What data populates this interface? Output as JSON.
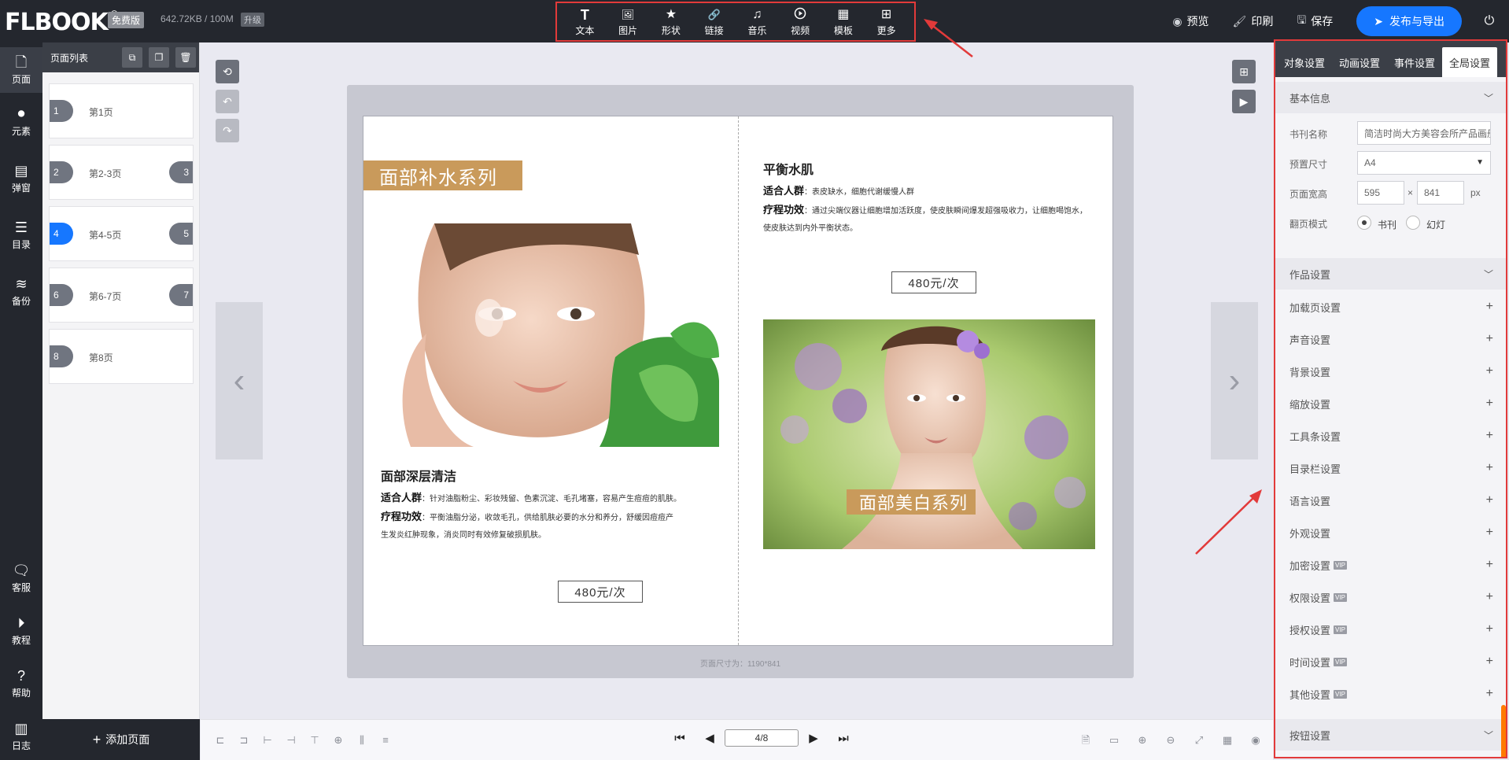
{
  "app": {
    "logo": "FLBOOK",
    "logo_mark": "®",
    "plan_badge": "免费版",
    "quota": "642.72KB / 100M",
    "upgrade": "升级"
  },
  "toolbar": [
    {
      "label": "文本",
      "icon": "T"
    },
    {
      "label": "图片",
      "icon": "🖼"
    },
    {
      "label": "形状",
      "icon": "★"
    },
    {
      "label": "链接",
      "icon": "🔗"
    },
    {
      "label": "音乐",
      "icon": "♫"
    },
    {
      "label": "视频",
      "icon": "▶"
    },
    {
      "label": "模板",
      "icon": "▦"
    },
    {
      "label": "更多",
      "icon": "⊞"
    }
  ],
  "top_actions": {
    "preview": "预览",
    "print": "印刷",
    "save": "保存",
    "publish": "发布与导出"
  },
  "leftnav": [
    {
      "label": "页面"
    },
    {
      "label": "元素"
    },
    {
      "label": "弹窗"
    },
    {
      "label": "目录"
    },
    {
      "label": "备份"
    },
    {
      "label": "客服"
    },
    {
      "label": "教程"
    },
    {
      "label": "帮助"
    },
    {
      "label": "日志"
    }
  ],
  "pagelist": {
    "title": "页面列表",
    "add_page": "添加页面",
    "pages": [
      {
        "num": "1",
        "name": "第1页",
        "right": ""
      },
      {
        "num": "2",
        "name": "第2-3页",
        "right": "3"
      },
      {
        "num": "4",
        "name": "第4-5页",
        "right": "5"
      },
      {
        "num": "6",
        "name": "第6-7页",
        "right": "7"
      },
      {
        "num": "8",
        "name": "第8页",
        "right": ""
      }
    ]
  },
  "book": {
    "left": {
      "banner": "面部补水系列",
      "title": "面部深层清洁",
      "audience_label": "适合人群",
      "audience_text": "：针对油脂粉尘、彩妆残留、色素沉淀、毛孔堵塞，容易产生痘痘的肌肤。",
      "effect_label": "疗程功效",
      "effect_text_1": "：平衡油脂分泌，收敛毛孔，供给肌肤必要的水分和养分，舒缓因痘痘产",
      "effect_text_2": "生发炎红肿现象，消炎同时有效修复破损肌肤。",
      "price": "480元/次"
    },
    "right": {
      "title": "平衡水肌",
      "audience_label": "适合人群",
      "audience_text": "：表皮缺水，细胞代谢缓慢人群",
      "effect_label": "疗程功效",
      "effect_text_1": "：通过尖端仪器让细胞增加活跃度，使皮肤瞬间爆发超强吸收力，让细胞喝饱水，",
      "effect_text_2": "使皮肤达到内外平衡状态。",
      "price": "480元/次",
      "banner": "面部美白系列"
    },
    "footer": "页面尺寸为：1190*841"
  },
  "pager": {
    "current": "4/8"
  },
  "rpanel": {
    "tabs": [
      "对象设置",
      "动画设置",
      "事件设置",
      "全局设置"
    ],
    "active_tab": 3,
    "basic_section": "基本信息",
    "fields": {
      "book_name_label": "书刊名称",
      "book_name_value": "简洁时尚大方美容会所产品画册",
      "preset_size_label": "预置尺寸",
      "preset_size_value": "A4",
      "page_size_label": "页面宽高",
      "page_width": "595",
      "times": "×",
      "page_height": "841",
      "unit": "px",
      "flip_mode_label": "翻页模式",
      "flip_book": "书刊",
      "flip_slide": "幻灯"
    },
    "work_section": "作品设置",
    "rows": [
      {
        "label": "加载页设置",
        "vip": ""
      },
      {
        "label": "声音设置",
        "vip": ""
      },
      {
        "label": "背景设置",
        "vip": ""
      },
      {
        "label": "缩放设置",
        "vip": ""
      },
      {
        "label": "工具条设置",
        "vip": ""
      },
      {
        "label": "目录栏设置",
        "vip": ""
      },
      {
        "label": "语言设置",
        "vip": ""
      },
      {
        "label": "外观设置",
        "vip": ""
      },
      {
        "label": "加密设置",
        "vip": "VIP"
      },
      {
        "label": "权限设置",
        "vip": "VIP"
      },
      {
        "label": "授权设置",
        "vip": "VIP"
      },
      {
        "label": "时间设置",
        "vip": "VIP"
      },
      {
        "label": "其他设置",
        "vip": "VIP"
      }
    ],
    "button_section": "按钮设置"
  },
  "colors": {
    "accent": "#1677ff",
    "banner": "#c99a5b",
    "annotation": "#e23a3a",
    "dark": "#24272e"
  }
}
